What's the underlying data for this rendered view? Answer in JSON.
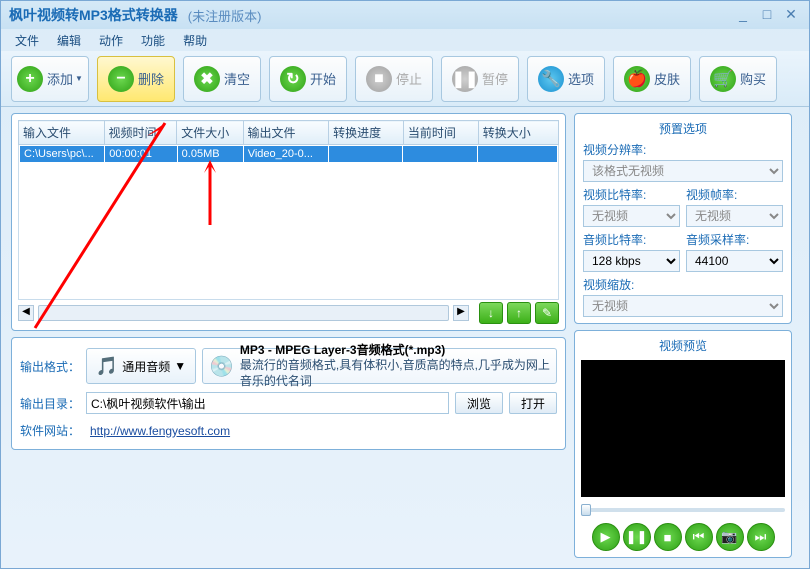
{
  "titlebar": {
    "title": "枫叶视频转MP3格式转换器",
    "subtitle": "(未注册版本)"
  },
  "menu": [
    "文件",
    "编辑",
    "动作",
    "功能",
    "帮助"
  ],
  "toolbar": {
    "add": "添加",
    "delete": "删除",
    "clear": "清空",
    "start": "开始",
    "stop": "停止",
    "pause": "暂停",
    "options": "选项",
    "skin": "皮肤",
    "buy": "购买"
  },
  "table": {
    "headers": [
      "输入文件",
      "视频时间",
      "文件大小",
      "输出文件",
      "转换进度",
      "当前时间",
      "转换大小"
    ],
    "rows": [
      {
        "input": "C:\\Users\\pc\\...",
        "time": "00:00:01",
        "size": "0.05MB",
        "output": "Video_20-0...",
        "progress": "",
        "curtime": "",
        "convsize": ""
      }
    ]
  },
  "output": {
    "format_label": "输出格式：",
    "format_button": "通用音频",
    "desc_title": "MP3 - MPEG Layer-3音频格式(*.mp3)",
    "desc_body": "最流行的音频格式,具有体积小,音质高的特点,几乎成为网上音乐的代名词",
    "dir_label": "输出目录：",
    "dir_value": "C:\\枫叶视频软件\\输出",
    "browse": "浏览",
    "open": "打开",
    "site_label": "软件网站：",
    "site_url": "http://www.fengyesoft.com"
  },
  "preset": {
    "title": "预置选项",
    "video_res": "视频分辨率:",
    "video_res_val": "该格式无视频",
    "video_bitrate": "视频比特率:",
    "video_bitrate_val": "无视频",
    "video_fps": "视频帧率:",
    "video_fps_val": "无视频",
    "audio_bitrate": "音频比特率:",
    "audio_bitrate_val": "128 kbps",
    "audio_sample": "音频采样率:",
    "audio_sample_val": "44100",
    "video_scale": "视频缩放:",
    "video_scale_val": "无视频"
  },
  "preview": {
    "title": "视频预览"
  }
}
